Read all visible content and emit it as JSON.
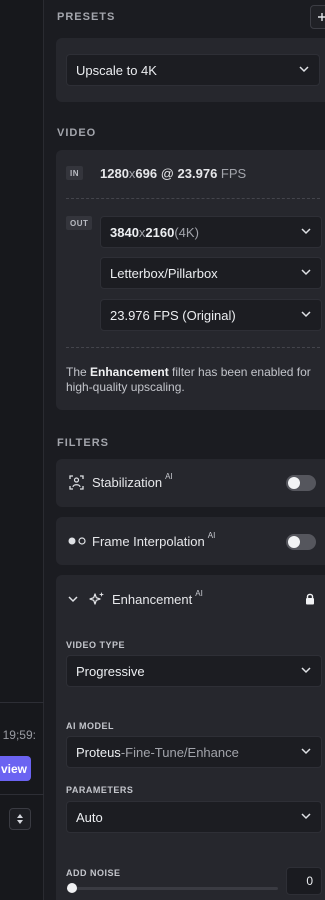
{
  "left": {
    "timecode": ":59;19",
    "preview_label": "view"
  },
  "presets": {
    "label": "PRESETS",
    "selected": "Upscale to 4K"
  },
  "video": {
    "label": "VIDEO",
    "in_tag": "IN",
    "in_res_w": "1280",
    "in_res_x": "x",
    "in_res_h": "696",
    "in_at": " @ ",
    "in_fps": "23.976",
    "in_fps_unit": " FPS",
    "out_tag": "OUT",
    "out_res_w": "3840",
    "out_res_x": "x",
    "out_res_h": "2160",
    "out_res_note": " (4K)",
    "crop_mode": "Letterbox/Pillarbox",
    "out_fps": "23.976 FPS (Original)",
    "note_pre": "The ",
    "note_bold": "Enhancement",
    "note_post": " filter has been enabled for high-quality upscaling."
  },
  "filters": {
    "label": "FILTERS",
    "ai_badge": "AI",
    "stabilization": "Stabilization",
    "frame_interpolation": "Frame Interpolation",
    "enhancement": "Enhancement",
    "video_type_label": "VIDEO TYPE",
    "video_type": "Progressive",
    "ai_model_label": "AI MODEL",
    "ai_model_name": "Proteus",
    "ai_model_sep": " - ",
    "ai_model_mode": "Fine-Tune/Enhance",
    "parameters_label": "PARAMETERS",
    "parameters": "Auto",
    "add_noise_label": "ADD NOISE",
    "add_noise_value": "0",
    "add_noise_level": 0
  },
  "colors": {
    "accent": "#6b63f2",
    "panel": "#26272d",
    "background": "#1b1c21"
  }
}
